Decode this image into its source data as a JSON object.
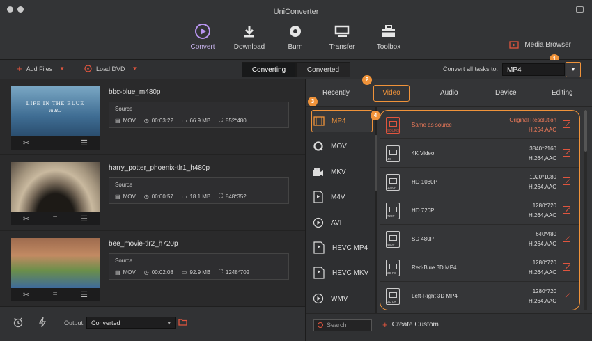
{
  "window": {
    "title": "UniConverter"
  },
  "nav": {
    "tabs": [
      {
        "label": "Convert",
        "icon": "convert-icon"
      },
      {
        "label": "Download",
        "icon": "download-icon"
      },
      {
        "label": "Burn",
        "icon": "burn-icon"
      },
      {
        "label": "Transfer",
        "icon": "transfer-icon"
      },
      {
        "label": "Toolbox",
        "icon": "toolbox-icon"
      }
    ],
    "active": "Convert",
    "media_browser": "Media Browser"
  },
  "toolbar": {
    "add_files": "Add Files",
    "load_dvd": "Load DVD",
    "segments": [
      "Converting",
      "Converted"
    ],
    "active_segment": "Converting",
    "convert_all_label": "Convert all tasks to:",
    "convert_all_value": "MP4"
  },
  "files": [
    {
      "name": "bbc-blue_m480p",
      "source_label": "Source",
      "format": "MOV",
      "duration": "00:03:22",
      "size": "66.9 MB",
      "resolution": "852*480"
    },
    {
      "name": "harry_potter_phoenix-tlr1_h480p",
      "source_label": "Source",
      "format": "MOV",
      "duration": "00:00:57",
      "size": "18.1 MB",
      "resolution": "848*352"
    },
    {
      "name": "bee_movie-tlr2_h720p",
      "source_label": "Source",
      "format": "MOV",
      "duration": "00:02:08",
      "size": "92.9 MB",
      "resolution": "1248*702"
    }
  ],
  "thumb1_text": {
    "line1": "LIFE IN THE BLUE",
    "line2": "in HD"
  },
  "bottom": {
    "output_label": "Output:",
    "output_value": "Converted"
  },
  "panel": {
    "tabs": [
      "Recently",
      "Video",
      "Audio",
      "Device",
      "Editing"
    ],
    "active_tab": "Video",
    "formats": [
      "MP4",
      "MOV",
      "MKV",
      "M4V",
      "AVI",
      "HEVC MP4",
      "HEVC MKV",
      "WMV"
    ],
    "selected_format": "MP4",
    "resolutions": [
      {
        "name": "Same as source",
        "line1": "Original Resolution",
        "line2": "H.264,AAC",
        "tag": "SOURCE"
      },
      {
        "name": "4K Video",
        "line1": "3840*2160",
        "line2": "H.264,AAC",
        "tag": "4K"
      },
      {
        "name": "HD 1080P",
        "line1": "1920*1080",
        "line2": "H.264,AAC",
        "tag": "1080P"
      },
      {
        "name": "HD 720P",
        "line1": "1280*720",
        "line2": "H.264,AAC",
        "tag": "720P"
      },
      {
        "name": "SD 480P",
        "line1": "640*480",
        "line2": "H.264,AAC",
        "tag": "480P"
      },
      {
        "name": "Red-Blue 3D MP4",
        "line1": "1280*720",
        "line2": "H.264,AAC",
        "tag": "3D RB"
      },
      {
        "name": "Left-Right 3D MP4",
        "line1": "1280*720",
        "line2": "H.264,AAC",
        "tag": "3D LR"
      }
    ],
    "search_placeholder": "Search",
    "create_custom": "Create Custom"
  },
  "badges": [
    "1",
    "2",
    "3",
    "4"
  ],
  "colors": {
    "accent": "#f0933a",
    "active_nav": "#8f6ad8",
    "edit_red": "#e0553e"
  }
}
